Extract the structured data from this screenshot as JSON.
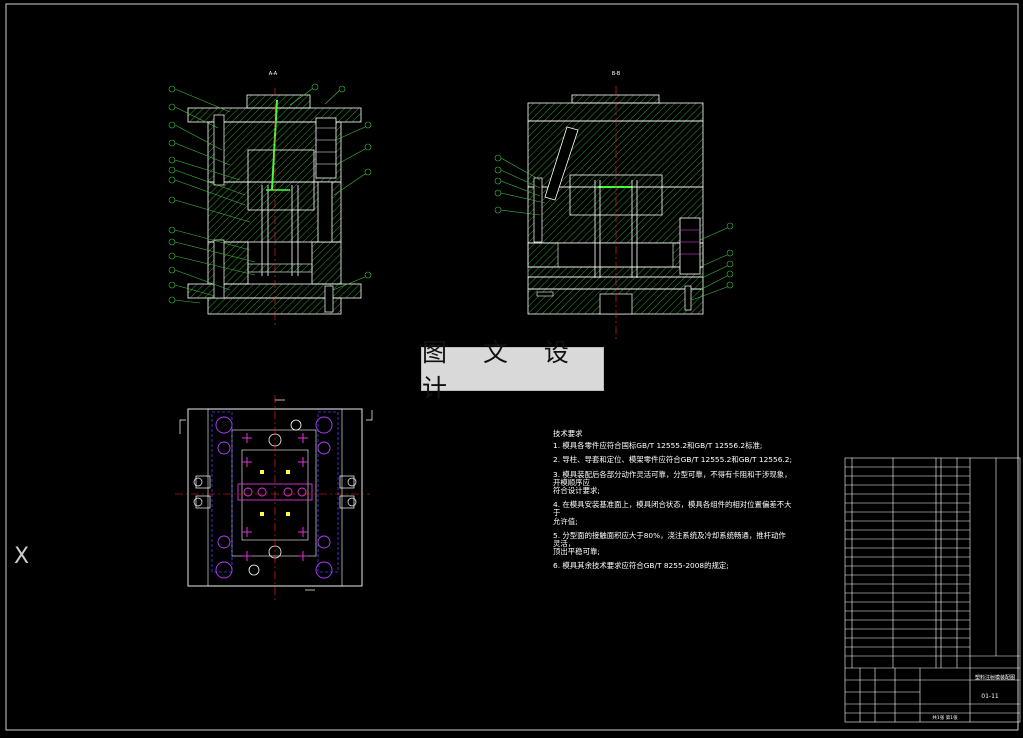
{
  "drawing": {
    "section_label_left": "A-A",
    "section_label_right": "B-B",
    "watermark_text": "图 文 设 计",
    "axis_glyph": "X"
  },
  "technical_requirements": {
    "heading": "技术要求",
    "items": [
      "1. 模具各零件应符合国标GB/T 12555.2和GB/T 12556.2标准;",
      "2. 导柱、导套和定位、模架零件应符合GB/T 12555.2和GB/T 12556.2;",
      "3. 模具装配后各部分动作灵活可靠，分型可靠，不得有卡阻和干涉现象，开模顺序应",
      "   符合设计要求;",
      "4. 在模具安装基准面上，模具闭合状态，模具各组件的相对位置偏差不大于",
      "   允许值;",
      "5. 分型面的接触面积应大于80%，浇注系统及冷却系统畅通，推杆动作灵活，",
      "   顶出平稳可靠;",
      "6. 模具其余技术要求应符合GB/T 8255-2008的规定;"
    ]
  },
  "title_block": {
    "drawing_name": "塑料注射模装配图",
    "drawing_no": "01-11",
    "scale_label": "共1张 第1张"
  },
  "colors": {
    "hatch": "#3fbf3f",
    "outline": "#ffffff",
    "red": "#ff2020",
    "magenta": "#e030e0",
    "blue": "#4040ff",
    "yellow": "#ffff40",
    "cyan": "#30d0d0"
  }
}
